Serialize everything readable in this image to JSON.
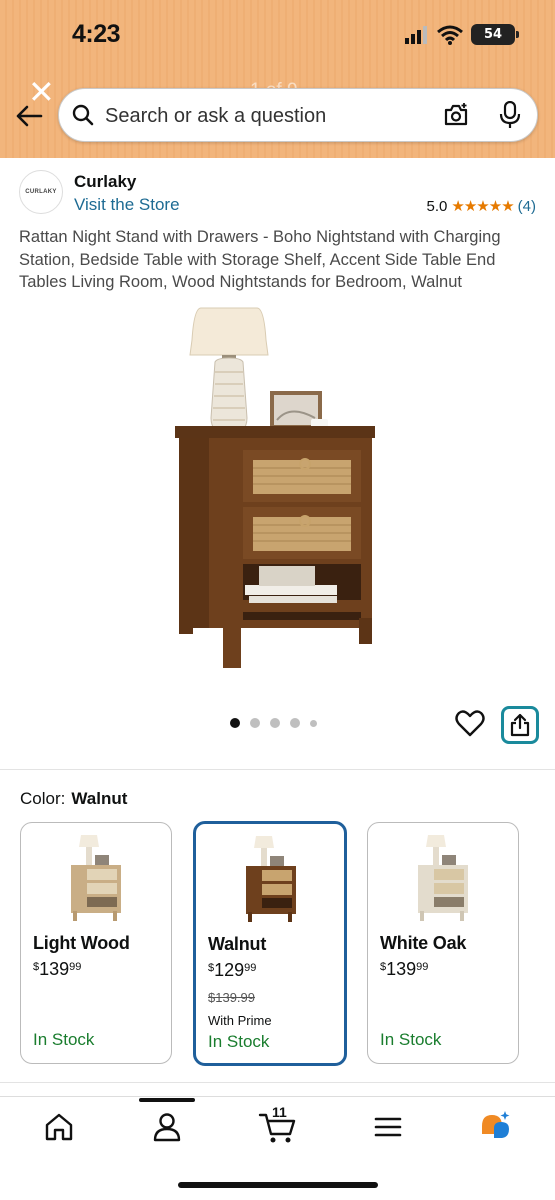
{
  "status_bar": {
    "time": "4:23",
    "battery": "54"
  },
  "header": {
    "search_placeholder": "Search or ask a question",
    "pager": "1 of 9"
  },
  "product": {
    "brand_logo_text": "CURLAKY",
    "brand": "Curlaky",
    "visit_store": "Visit the Store",
    "rating": "5.0",
    "rating_count": "(4)",
    "stars": "★★★★★",
    "title": "Rattan Night Stand with Drawers - Boho Nightstand with Charging Station, Bedside Table with Storage Shelf, Accent Side Table End Tables Living Room, Wood Nightstands for Bedroom, Walnut",
    "image_count": 5,
    "active_image": 1
  },
  "color": {
    "label": "Color:",
    "selected": "Walnut",
    "options": [
      {
        "name": "Light Wood",
        "currency": "$",
        "whole": "139",
        "cents": "99",
        "was": "",
        "prime": "",
        "stock": "In Stock"
      },
      {
        "name": "Walnut",
        "currency": "$",
        "whole": "129",
        "cents": "99",
        "was": "$139.99",
        "prime": "With Prime",
        "stock": "In Stock"
      },
      {
        "name": "White Oak",
        "currency": "$",
        "whole": "139",
        "cents": "99",
        "was": "",
        "prime": "",
        "stock": "In Stock"
      }
    ]
  },
  "nav": {
    "cart_count": "11"
  },
  "colors": {
    "header_bg": "#f2b57c",
    "link": "#1e6b93",
    "star": "#e67a00",
    "in_stock": "#1a7d2e",
    "selected_border": "#1f5f9b",
    "share_border": "#1a8a9c"
  },
  "icons": [
    "back-arrow-icon",
    "close-icon",
    "search-icon",
    "camera-icon",
    "mic-icon",
    "heart-icon",
    "share-icon",
    "home-icon",
    "account-icon",
    "cart-icon",
    "menu-icon",
    "rufus-icon"
  ]
}
